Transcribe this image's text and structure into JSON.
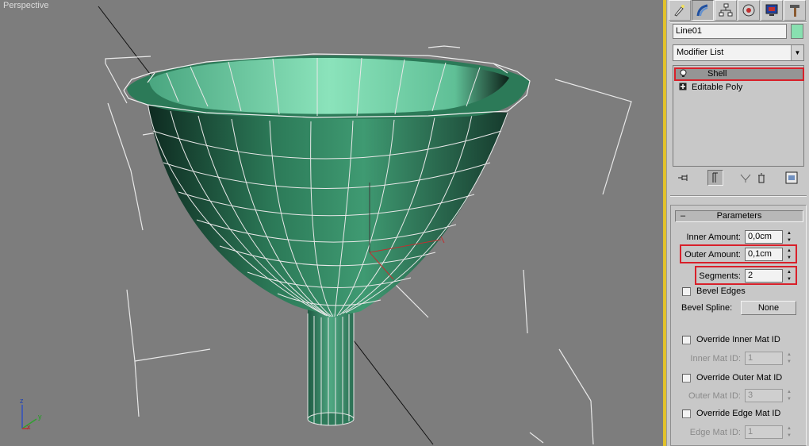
{
  "viewport": {
    "label": "Perspective",
    "gizmo": {
      "z": "z",
      "y": "y",
      "x": "x"
    }
  },
  "command_panel": {
    "tabs": [
      {
        "name": "create",
        "icon": "create-icon"
      },
      {
        "name": "modify",
        "icon": "modify-icon",
        "active": true
      },
      {
        "name": "hierarchy",
        "icon": "hierarchy-icon"
      },
      {
        "name": "motion",
        "icon": "motion-icon"
      },
      {
        "name": "display",
        "icon": "display-icon"
      },
      {
        "name": "utilities",
        "icon": "utilities-icon"
      }
    ],
    "object_name": "Line01",
    "object_color": "#88e0b0",
    "modifier_list": "Modifier List",
    "stack": [
      {
        "label": "Shell",
        "selected": true
      },
      {
        "label": "Editable Poly",
        "selected": false
      }
    ],
    "parameters": {
      "title": "Parameters",
      "inner_amount_label": "Inner Amount:",
      "inner_amount": "0,0cm",
      "outer_amount_label": "Outer Amount:",
      "outer_amount": "0,1cm",
      "segments_label": "Segments:",
      "segments": "2",
      "bevel_edges": "Bevel Edges",
      "bevel_spline_label": "Bevel Spline:",
      "bevel_spline_value": "None",
      "override_inner": "Override Inner Mat ID",
      "inner_mat_label": "Inner Mat ID:",
      "inner_mat": "1",
      "override_outer": "Override Outer Mat ID",
      "outer_mat_label": "Outer Mat ID:",
      "outer_mat": "3",
      "override_edge": "Override Edge Mat ID",
      "edge_mat_label": "Edge Mat ID:",
      "edge_mat": "1"
    },
    "highlight_color": "#d8202a"
  }
}
